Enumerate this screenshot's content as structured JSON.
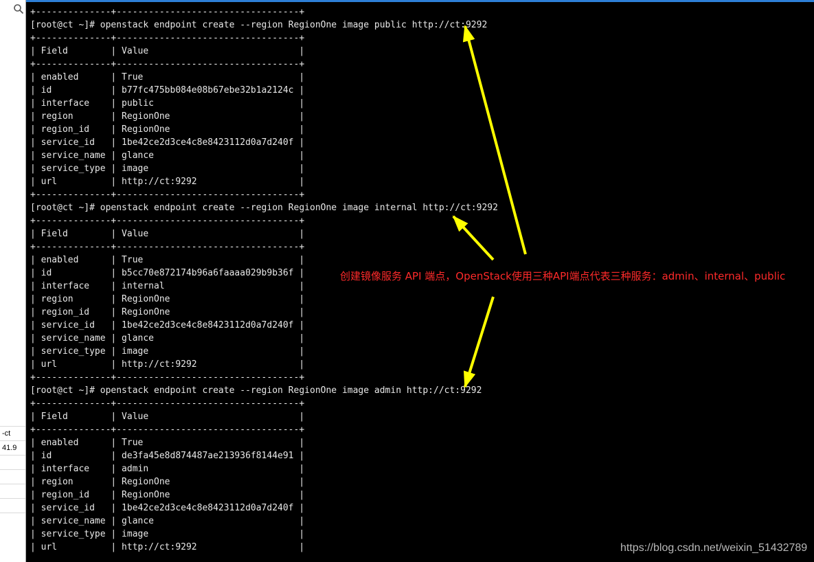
{
  "side_panel": {
    "rows": [
      {
        "text": ""
      },
      {
        "text": "-ct"
      },
      {
        "text": "41.9"
      },
      {
        "text": ""
      },
      {
        "text": ""
      },
      {
        "text": ""
      },
      {
        "text": ""
      }
    ],
    "search_icon": "search-icon"
  },
  "terminal": {
    "lines": [
      "+--------------+----------------------------------+",
      "[root@ct ~]# openstack endpoint create --region RegionOne image public http://ct:9292",
      "+--------------+----------------------------------+",
      "| Field        | Value                            |",
      "+--------------+----------------------------------+",
      "| enabled      | True                             |",
      "| id           | b77fc475bb084e08b67ebe32b1a2124c |",
      "| interface    | public                           |",
      "| region       | RegionOne                        |",
      "| region_id    | RegionOne                        |",
      "| service_id   | 1be42ce2d3ce4c8e8423112d0a7d240f |",
      "| service_name | glance                           |",
      "| service_type | image                            |",
      "| url          | http://ct:9292                   |",
      "+--------------+----------------------------------+",
      "[root@ct ~]# openstack endpoint create --region RegionOne image internal http://ct:9292",
      "+--------------+----------------------------------+",
      "| Field        | Value                            |",
      "+--------------+----------------------------------+",
      "| enabled      | True                             |",
      "| id           | b5cc70e872174b96a6faaaa029b9b36f |",
      "| interface    | internal                         |",
      "| region       | RegionOne                        |",
      "| region_id    | RegionOne                        |",
      "| service_id   | 1be42ce2d3ce4c8e8423112d0a7d240f |",
      "| service_name | glance                           |",
      "| service_type | image                            |",
      "| url          | http://ct:9292                   |",
      "+--------------+----------------------------------+",
      "[root@ct ~]# openstack endpoint create --region RegionOne image admin http://ct:9292",
      "+--------------+----------------------------------+",
      "| Field        | Value                            |",
      "+--------------+----------------------------------+",
      "| enabled      | True                             |",
      "| id           | de3fa45e8d874487ae213936f8144e91 |",
      "| interface    | admin                            |",
      "| region       | RegionOne                        |",
      "| region_id    | RegionOne                        |",
      "| service_id   | 1be42ce2d3ce4c8e8423112d0a7d240f |",
      "| service_name | glance                           |",
      "| service_type | image                            |",
      "| url          | http://ct:9292                   |"
    ]
  },
  "annotation": {
    "text": "创建镜像服务 API 端点，OpenStack使用三种API端点代表三种服务：admin、internal、public",
    "color": "#ff2a2a"
  },
  "arrow_color": "#ffff00",
  "watermark": "https://blog.csdn.net/weixin_51432789"
}
